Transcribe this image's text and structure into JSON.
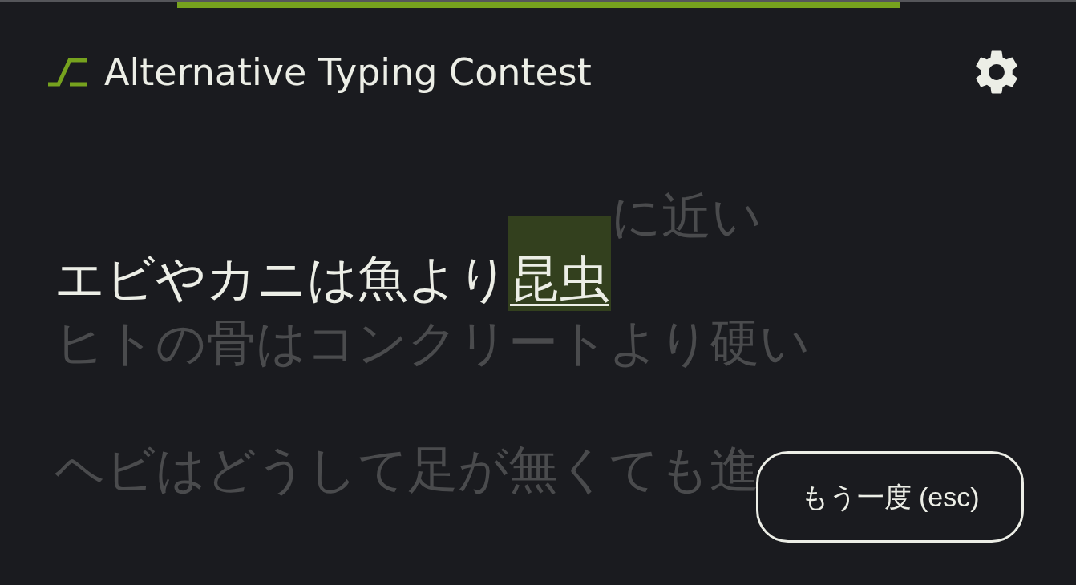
{
  "header": {
    "title": "Alternative Typing Contest"
  },
  "lines": [
    {
      "segments": [
        {
          "kind": "typed",
          "text": "エビやカニは魚より"
        },
        {
          "kind": "current",
          "text": "昆虫"
        },
        {
          "kind": "pending",
          "text": "に近い"
        }
      ]
    },
    {
      "segments": [
        {
          "kind": "upcoming",
          "text": "ヒトの骨はコンクリートより硬い"
        }
      ]
    },
    {
      "segments": [
        {
          "kind": "upcoming",
          "text": "ヘビはどうして足が無くても進"
        }
      ]
    }
  ],
  "retry_button": {
    "label": "もう一度 (esc)"
  }
}
